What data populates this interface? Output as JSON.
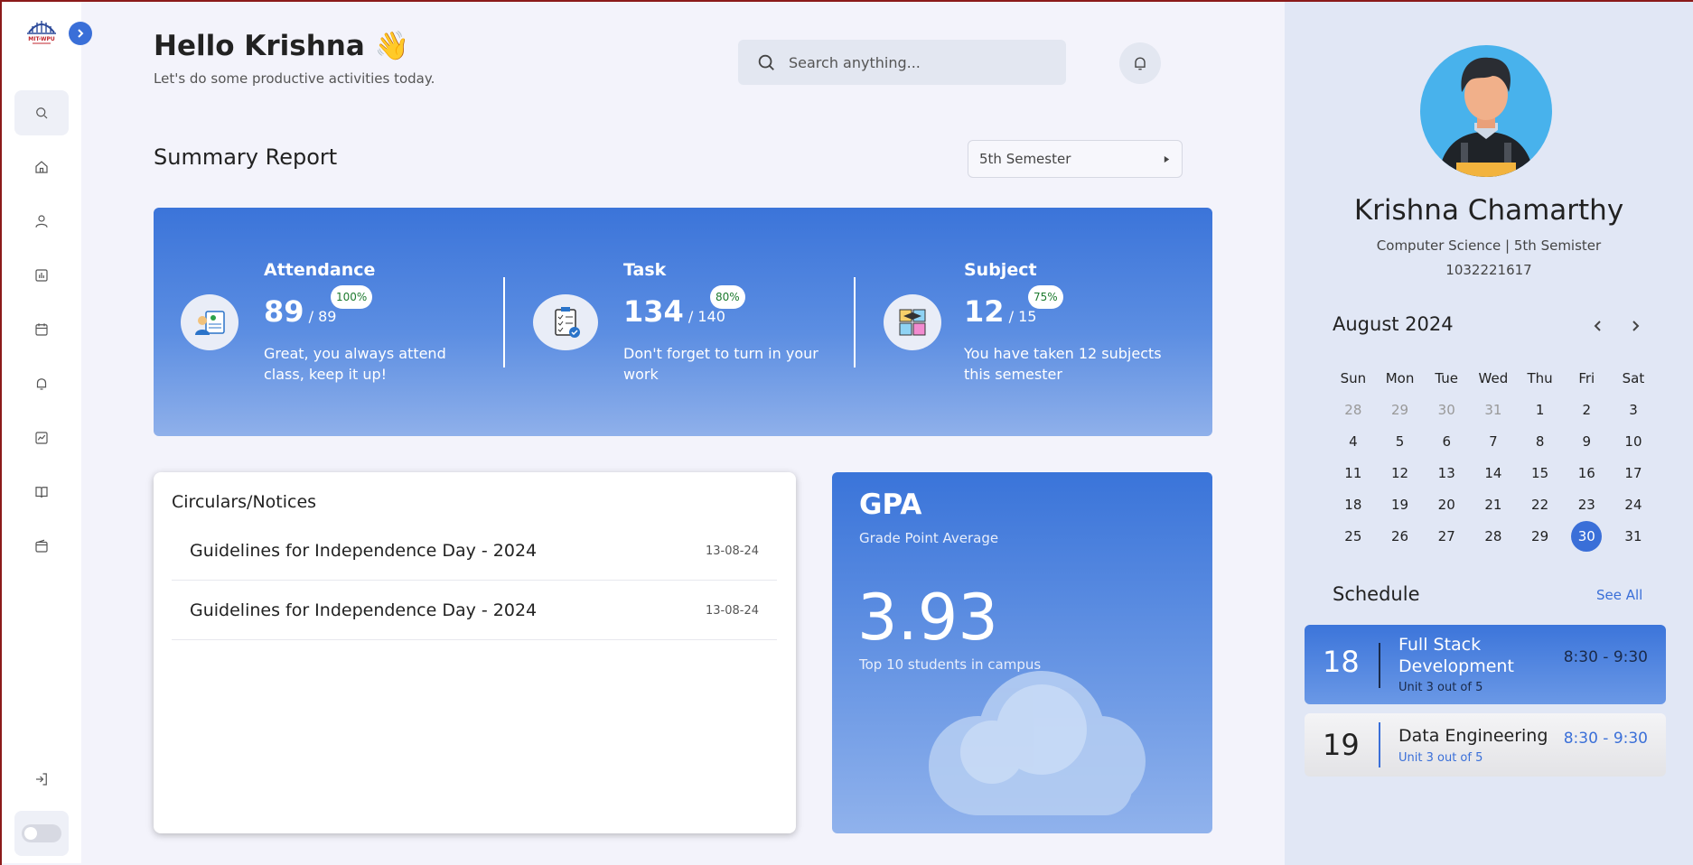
{
  "sidebar": {
    "logo_text": "MIT-WPU",
    "items": [
      "search",
      "home",
      "profile",
      "reports",
      "calendar",
      "notifications",
      "analytics",
      "library",
      "wallet"
    ]
  },
  "header": {
    "greeting": "Hello Krishna 👋",
    "subtitle": "Let's do some productive activities today.",
    "search_placeholder": "Search anything..."
  },
  "summary": {
    "title": "Summary Report",
    "semester": "5th Semester",
    "stats": [
      {
        "label": "Attendance",
        "value": "89",
        "total": "/ 89",
        "percent": "100%",
        "desc": "Great, you always attend class, keep it up!"
      },
      {
        "label": "Task",
        "value": "134",
        "total": "/ 140",
        "percent": "80%",
        "desc": "Don't forget to turn in your work"
      },
      {
        "label": "Subject",
        "value": "12",
        "total": "/ 15",
        "percent": "75%",
        "desc": "You have taken 12 subjects this semester"
      }
    ]
  },
  "circulars": {
    "title": "Circulars/Notices",
    "items": [
      {
        "title": "Guidelines for Independence Day - 2024",
        "date": "13-08-24"
      },
      {
        "title": "Guidelines for Independence Day - 2024",
        "date": "13-08-24"
      }
    ]
  },
  "gpa": {
    "title": "GPA",
    "subtitle": "Grade Point Average",
    "value": "3.93",
    "note": "Top 10 students in campus"
  },
  "profile": {
    "name": "Krishna Chamarthy",
    "dept": "Computer Science | 5th Semister",
    "roll": "1032221617"
  },
  "calendar": {
    "month": "August 2024",
    "weekdays": [
      "Sun",
      "Mon",
      "Tue",
      "Wed",
      "Thu",
      "Fri",
      "Sat"
    ],
    "weeks": [
      [
        "28",
        "29",
        "30",
        "31",
        "1",
        "2",
        "3"
      ],
      [
        "4",
        "5",
        "6",
        "7",
        "8",
        "9",
        "10"
      ],
      [
        "11",
        "12",
        "13",
        "14",
        "15",
        "16",
        "17"
      ],
      [
        "18",
        "19",
        "20",
        "21",
        "22",
        "23",
        "24"
      ],
      [
        "25",
        "26",
        "27",
        "28",
        "29",
        "30",
        "31"
      ]
    ],
    "today": "30"
  },
  "schedule": {
    "title": "Schedule",
    "see_all": "See All",
    "items": [
      {
        "day": "18",
        "title": "Full Stack Development",
        "unit": "Unit 3 out of 5",
        "time": "8:30 - 9:30"
      },
      {
        "day": "19",
        "title": "Data Engineering",
        "unit": "Unit 3 out of 5",
        "time": "8:30 - 9:30"
      }
    ]
  },
  "colors": {
    "accent": "#3a6fd8",
    "percent_text": "#1d7a2e",
    "panel": "#e1e7f5"
  }
}
